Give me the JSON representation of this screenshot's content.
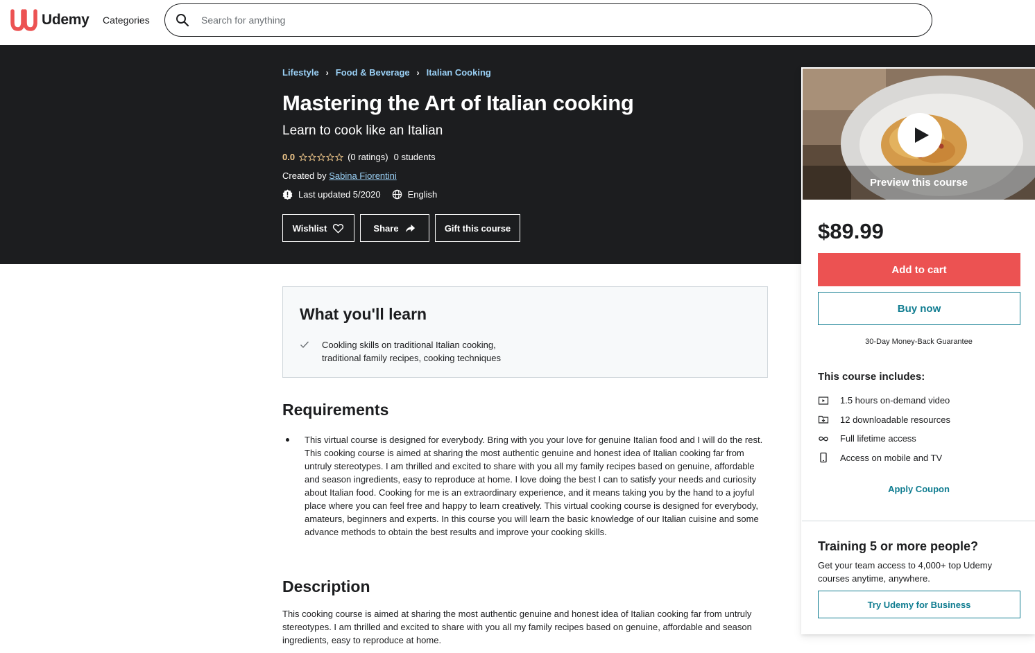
{
  "header": {
    "logo_text": "Udemy",
    "categories_label": "Categories",
    "search_placeholder": "Search for anything"
  },
  "hero": {
    "breadcrumbs": [
      "Lifestyle",
      "Food & Beverage",
      "Italian Cooking"
    ],
    "title": "Mastering the Art of Italian cooking",
    "subtitle": "Learn to cook like an Italian",
    "rating_value": "0.0",
    "stars_filled": 0,
    "stars_total": 5,
    "ratings_count": "(0 ratings)",
    "students": "0 students",
    "created_by_label": "Created by",
    "instructor": "Sabina Fiorentini",
    "last_updated": "Last updated 5/2020",
    "language": "English",
    "buttons": {
      "wishlist": "Wishlist",
      "share": "Share",
      "gift": "Gift this course"
    }
  },
  "sidebar": {
    "preview_label": "Preview this course",
    "price": "$89.99",
    "add_to_cart": "Add to cart",
    "buy_now": "Buy now",
    "guarantee": "30-Day Money-Back Guarantee",
    "includes_title": "This course includes:",
    "includes": [
      {
        "icon": "video-icon",
        "label": "1.5 hours on-demand video"
      },
      {
        "icon": "download-icon",
        "label": "12 downloadable resources"
      },
      {
        "icon": "infinity-icon",
        "label": "Full lifetime access"
      },
      {
        "icon": "mobile-icon",
        "label": "Access on mobile and TV"
      }
    ],
    "apply_coupon": "Apply Coupon",
    "training_title": "Training 5 or more people?",
    "training_text": "Get your team access to 4,000+ top Udemy courses anytime, anywhere.",
    "try_business": "Try Udemy for Business"
  },
  "learn": {
    "title": "What you'll learn",
    "items": [
      "Cookling skills on traditional Italian cooking, traditional family recipes, cooking techniques"
    ]
  },
  "requirements": {
    "title": "Requirements",
    "items": [
      "This virtual course is designed for everybody. Bring with you your love for genuine Italian food and I will do the rest. This cooking course is aimed at sharing the most authentic genuine and honest idea of Italian cooking far from untruly stereotypes. I am thrilled and excited to share with you all my family recipes based on genuine, affordable and season ingredients, easy to reproduce at home. I love doing the best I can to satisfy your needs and curiosity about Italian food. Cooking for me is an extraordinary experience, and it means taking you by the hand to a joyful place where you can feel free and happy to learn creatively. This virtual cooking course is designed for everybody, amateurs, beginners and experts. In this course you will learn the basic knowledge of our Italian cuisine and some advance methods to obtain the best results and improve your cooking skills."
    ]
  },
  "description": {
    "title": "Description",
    "text": "This cooking course is aimed at sharing the most authentic genuine and honest idea of Italian cooking far from untruly stereotypes. I am thrilled and excited to share with you all my family recipes based on genuine, affordable and season ingredients, easy to reproduce at home."
  },
  "colors": {
    "hero_bg": "#1c1d1f",
    "brand_red": "#ec5252",
    "teal": "#0f7c90",
    "rating_gold": "#f3ca8c",
    "link_blue": "#9ad0f5"
  }
}
